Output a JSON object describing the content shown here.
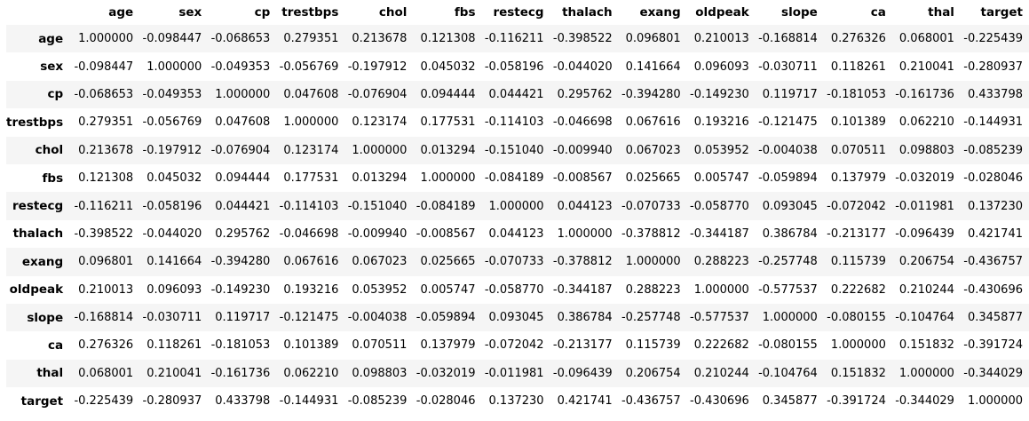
{
  "table": {
    "index_header": "",
    "columns": [
      "age",
      "sex",
      "cp",
      "trestbps",
      "chol",
      "fbs",
      "restecg",
      "thalach",
      "exang",
      "oldpeak",
      "slope",
      "ca",
      "thal",
      "target"
    ],
    "rows": [
      {
        "label": "age",
        "values": [
          "1.000000",
          "-0.098447",
          "-0.068653",
          "0.279351",
          "0.213678",
          "0.121308",
          "-0.116211",
          "-0.398522",
          "0.096801",
          "0.210013",
          "-0.168814",
          "0.276326",
          "0.068001",
          "-0.225439"
        ]
      },
      {
        "label": "sex",
        "values": [
          "-0.098447",
          "1.000000",
          "-0.049353",
          "-0.056769",
          "-0.197912",
          "0.045032",
          "-0.058196",
          "-0.044020",
          "0.141664",
          "0.096093",
          "-0.030711",
          "0.118261",
          "0.210041",
          "-0.280937"
        ]
      },
      {
        "label": "cp",
        "values": [
          "-0.068653",
          "-0.049353",
          "1.000000",
          "0.047608",
          "-0.076904",
          "0.094444",
          "0.044421",
          "0.295762",
          "-0.394280",
          "-0.149230",
          "0.119717",
          "-0.181053",
          "-0.161736",
          "0.433798"
        ]
      },
      {
        "label": "trestbps",
        "values": [
          "0.279351",
          "-0.056769",
          "0.047608",
          "1.000000",
          "0.123174",
          "0.177531",
          "-0.114103",
          "-0.046698",
          "0.067616",
          "0.193216",
          "-0.121475",
          "0.101389",
          "0.062210",
          "-0.144931"
        ]
      },
      {
        "label": "chol",
        "values": [
          "0.213678",
          "-0.197912",
          "-0.076904",
          "0.123174",
          "1.000000",
          "0.013294",
          "-0.151040",
          "-0.009940",
          "0.067023",
          "0.053952",
          "-0.004038",
          "0.070511",
          "0.098803",
          "-0.085239"
        ]
      },
      {
        "label": "fbs",
        "values": [
          "0.121308",
          "0.045032",
          "0.094444",
          "0.177531",
          "0.013294",
          "1.000000",
          "-0.084189",
          "-0.008567",
          "0.025665",
          "0.005747",
          "-0.059894",
          "0.137979",
          "-0.032019",
          "-0.028046"
        ]
      },
      {
        "label": "restecg",
        "values": [
          "-0.116211",
          "-0.058196",
          "0.044421",
          "-0.114103",
          "-0.151040",
          "-0.084189",
          "1.000000",
          "0.044123",
          "-0.070733",
          "-0.058770",
          "0.093045",
          "-0.072042",
          "-0.011981",
          "0.137230"
        ]
      },
      {
        "label": "thalach",
        "values": [
          "-0.398522",
          "-0.044020",
          "0.295762",
          "-0.046698",
          "-0.009940",
          "-0.008567",
          "0.044123",
          "1.000000",
          "-0.378812",
          "-0.344187",
          "0.386784",
          "-0.213177",
          "-0.096439",
          "0.421741"
        ]
      },
      {
        "label": "exang",
        "values": [
          "0.096801",
          "0.141664",
          "-0.394280",
          "0.067616",
          "0.067023",
          "0.025665",
          "-0.070733",
          "-0.378812",
          "1.000000",
          "0.288223",
          "-0.257748",
          "0.115739",
          "0.206754",
          "-0.436757"
        ]
      },
      {
        "label": "oldpeak",
        "values": [
          "0.210013",
          "0.096093",
          "-0.149230",
          "0.193216",
          "0.053952",
          "0.005747",
          "-0.058770",
          "-0.344187",
          "0.288223",
          "1.000000",
          "-0.577537",
          "0.222682",
          "0.210244",
          "-0.430696"
        ]
      },
      {
        "label": "slope",
        "values": [
          "-0.168814",
          "-0.030711",
          "0.119717",
          "-0.121475",
          "-0.004038",
          "-0.059894",
          "0.093045",
          "0.386784",
          "-0.257748",
          "-0.577537",
          "1.000000",
          "-0.080155",
          "-0.104764",
          "0.345877"
        ]
      },
      {
        "label": "ca",
        "values": [
          "0.276326",
          "0.118261",
          "-0.181053",
          "0.101389",
          "0.070511",
          "0.137979",
          "-0.072042",
          "-0.213177",
          "0.115739",
          "0.222682",
          "-0.080155",
          "1.000000",
          "0.151832",
          "-0.391724"
        ]
      },
      {
        "label": "thal",
        "values": [
          "0.068001",
          "0.210041",
          "-0.161736",
          "0.062210",
          "0.098803",
          "-0.032019",
          "-0.011981",
          "-0.096439",
          "0.206754",
          "0.210244",
          "-0.104764",
          "0.151832",
          "1.000000",
          "-0.344029"
        ]
      },
      {
        "label": "target",
        "values": [
          "-0.225439",
          "-0.280937",
          "0.433798",
          "-0.144931",
          "-0.085239",
          "-0.028046",
          "0.137230",
          "0.421741",
          "-0.436757",
          "-0.430696",
          "0.345877",
          "-0.391724",
          "-0.344029",
          "1.000000"
        ]
      }
    ]
  },
  "colors": {
    "stripe": "#f5f5f5",
    "background": "#ffffff",
    "text": "#000000"
  }
}
